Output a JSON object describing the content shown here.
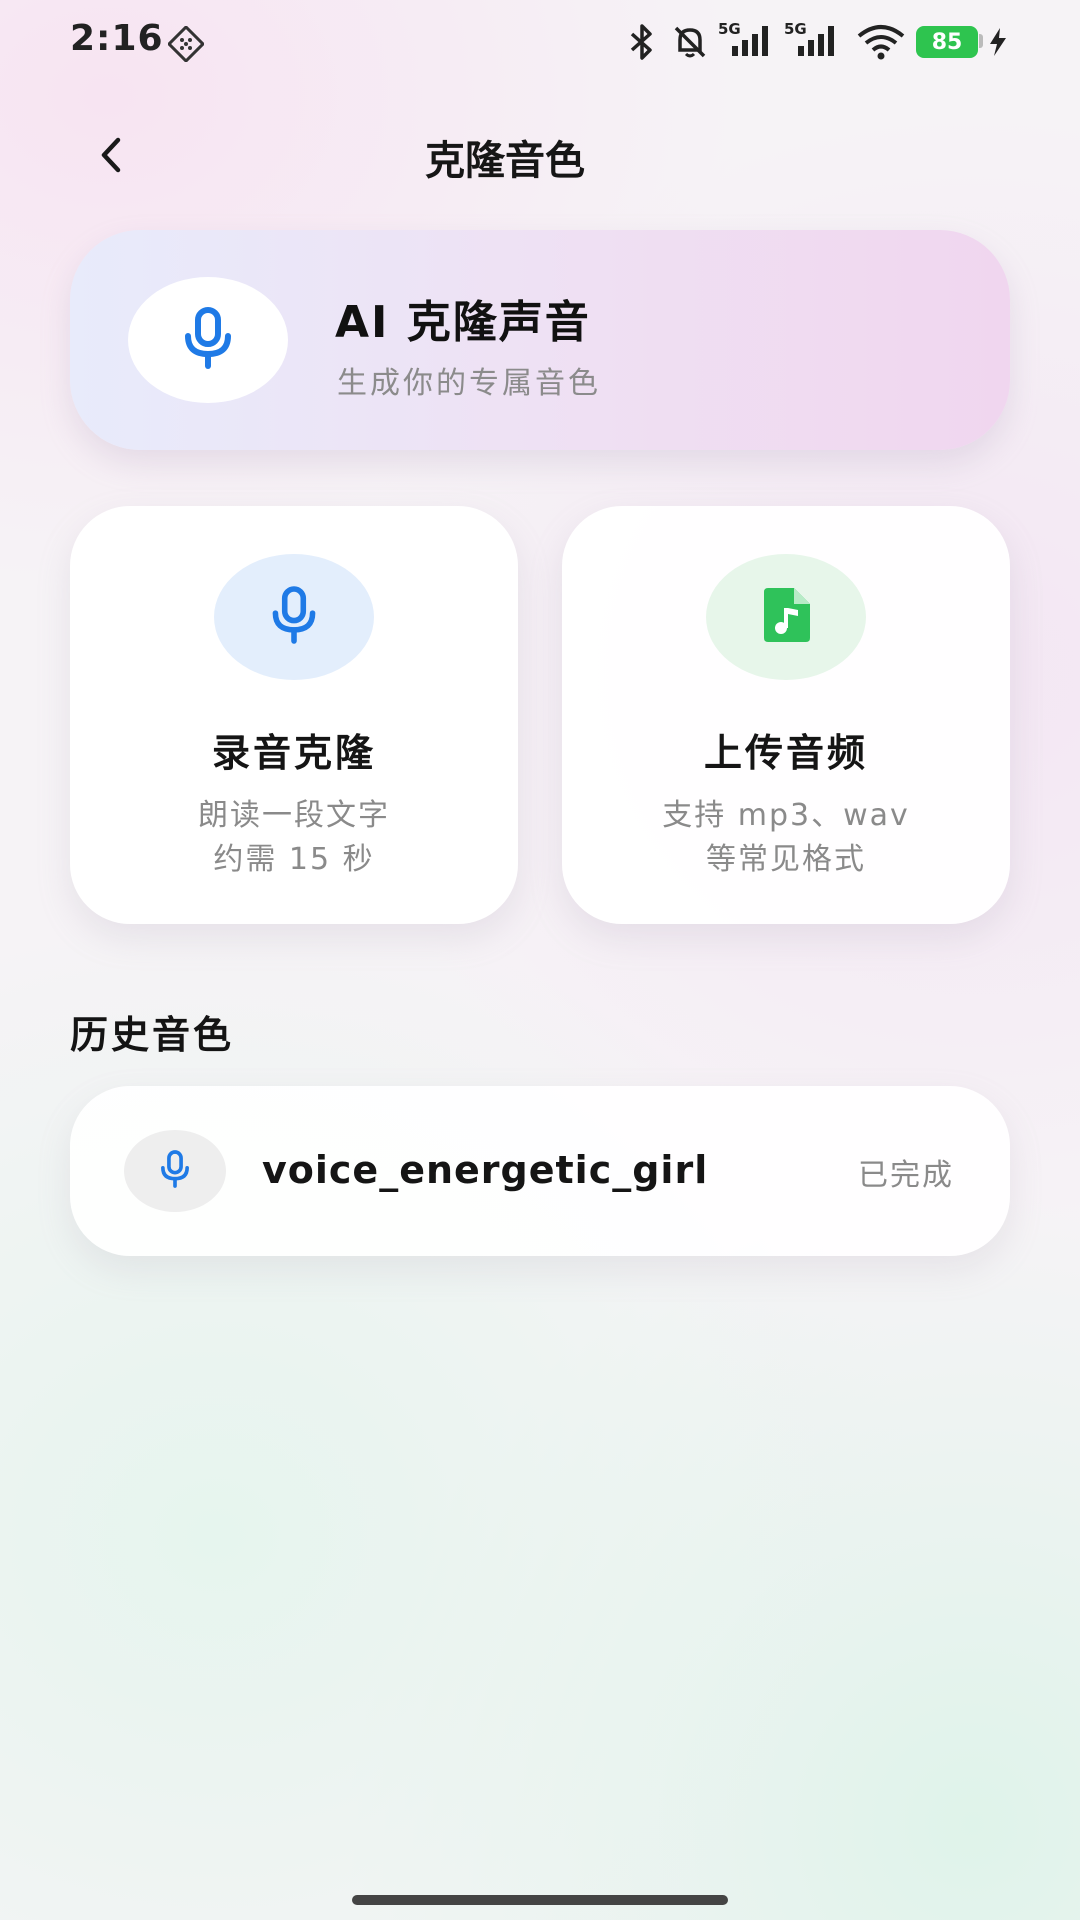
{
  "status_bar": {
    "time": "2:16",
    "signal1_label": "5G",
    "signal2_label": "5G",
    "battery": "85",
    "icons": [
      "dots-app-icon",
      "bluetooth-icon",
      "bell-off-icon",
      "signal-icon",
      "signal-icon",
      "wifi-icon",
      "battery-icon",
      "charging-icon"
    ]
  },
  "header": {
    "title": "克隆音色",
    "back_icon": "chevron-left-icon"
  },
  "hero": {
    "title": "AI 克隆声音",
    "subtitle": "生成你的专属音色",
    "icon": "microphone-icon"
  },
  "options": [
    {
      "title": "录音克隆",
      "desc_line1": "朗读一段文字",
      "desc_line2": "约需 15 秒",
      "icon": "microphone-icon",
      "icon_color": "#1f7ae6",
      "icon_bg": "#e3eefc"
    },
    {
      "title": "上传音频",
      "desc_line1": "支持 mp3、wav",
      "desc_line2": "等常见格式",
      "icon": "music-file-icon",
      "icon_color": "#2fc25a",
      "icon_bg": "#e7f6ea"
    }
  ],
  "history": {
    "section_title": "历史音色",
    "items": [
      {
        "name": "voice_energetic_girl",
        "status": "已完成",
        "icon": "microphone-icon"
      }
    ]
  },
  "colors": {
    "accent_blue": "#1f7ae6",
    "accent_green": "#2fc25a",
    "battery_green": "#2ec44f"
  }
}
